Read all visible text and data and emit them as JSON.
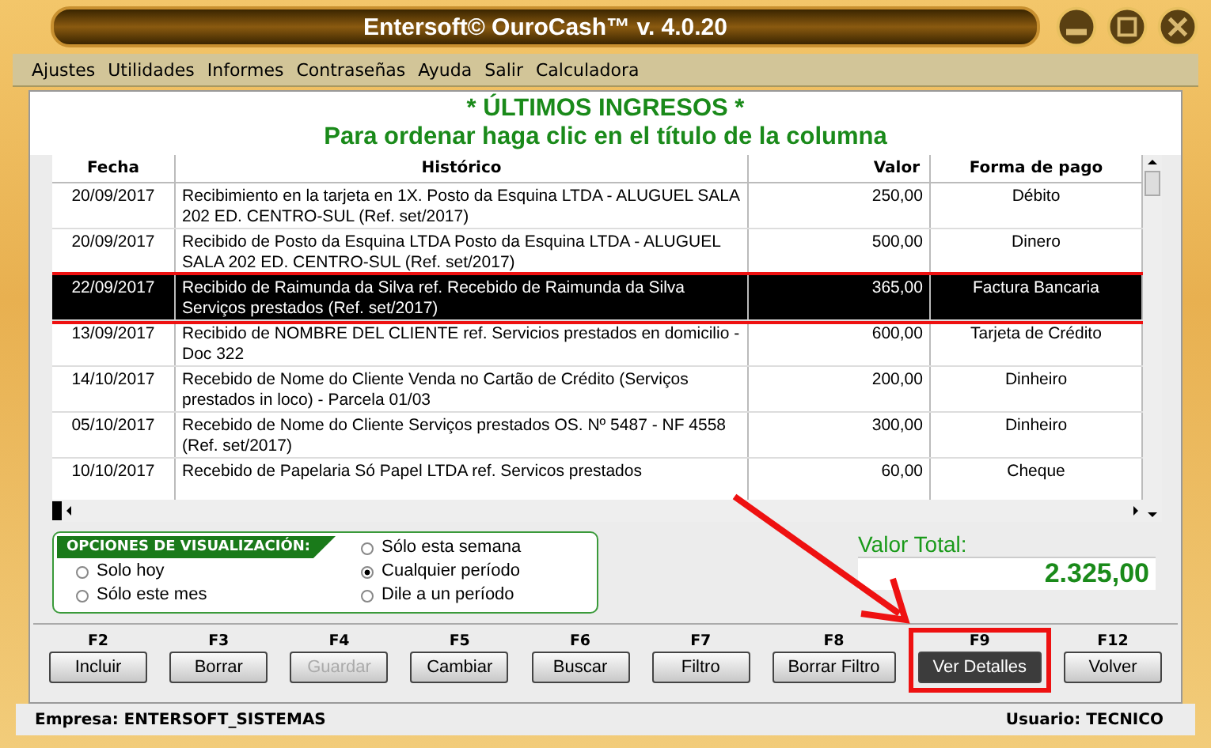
{
  "window": {
    "title": "Entersoft© OuroCash™ v. 4.0.20"
  },
  "menu": [
    "Ajustes",
    "Utilidades",
    "Informes",
    "Contraseñas",
    "Ayuda",
    "Salir",
    "Calculadora"
  ],
  "heading": "* ÚLTIMOS INGRESOS *",
  "subheading": "Para ordenar haga clic en el título de la columna",
  "table": {
    "columns": [
      "Fecha",
      "Histórico",
      "Valor",
      "Forma de pago"
    ],
    "rows": [
      {
        "cells": [
          "20/09/2017",
          "Recibimiento en la tarjeta en 1X. Posto da Esquina LTDA - ALUGUEL SALA 202 ED. CENTRO-SUL (Ref. set/2017)",
          "250,00",
          "Débito"
        ],
        "selected": false,
        "highlighted": false
      },
      {
        "cells": [
          "20/09/2017",
          "Recibido de Posto da Esquina LTDA Posto da Esquina LTDA - ALUGUEL SALA 202 ED. CENTRO-SUL (Ref. set/2017)",
          "500,00",
          "Dinero"
        ],
        "selected": false,
        "highlighted": false
      },
      {
        "cells": [
          "22/09/2017",
          "Recibido de Raimunda da Silva ref. Recebido de Raimunda da Silva Serviços prestados (Ref. set/2017)",
          "365,00",
          "Factura Bancaria"
        ],
        "selected": true,
        "highlighted": true
      },
      {
        "cells": [
          "13/09/2017",
          "Recibido de NOMBRE DEL CLIENTE ref. Servicios prestados en domicilio - Doc 322",
          "600,00",
          "Tarjeta de Crédito"
        ],
        "selected": false,
        "highlighted": false
      },
      {
        "cells": [
          "14/10/2017",
          "Recebido de Nome do Cliente Venda no Cartão de Crédito (Serviços prestados in loco) - Parcela 01/03",
          "200,00",
          "Dinheiro"
        ],
        "selected": false,
        "highlighted": false
      },
      {
        "cells": [
          "05/10/2017",
          "Recebido de Nome do Cliente Serviços prestados OS. Nº 5487 - NF 4558 (Ref. set/2017)",
          "300,00",
          "Dinheiro"
        ],
        "selected": false,
        "highlighted": false
      },
      {
        "cells": [
          "10/10/2017",
          "Recebido de Papelaria Só Papel LTDA ref. Servicos prestados",
          "60,00",
          "Cheque"
        ],
        "selected": false,
        "highlighted": false
      }
    ]
  },
  "view_options": {
    "title": "OPCIONES DE VISUALIZACIÓN:",
    "options_left": [
      {
        "label": "Solo hoy",
        "selected": false
      },
      {
        "label": "Sólo este mes",
        "selected": false
      }
    ],
    "options_right": [
      {
        "label": "Sólo esta semana",
        "selected": false
      },
      {
        "label": "Cualquier período",
        "selected": true
      },
      {
        "label": "Dile a un período",
        "selected": false
      }
    ]
  },
  "total": {
    "label": "Valor Total:",
    "value": "2.325,00"
  },
  "buttons": [
    {
      "key": "F2",
      "label": "Incluir",
      "disabled": false,
      "selected": false,
      "highlighted": false
    },
    {
      "key": "F3",
      "label": "Borrar",
      "disabled": false,
      "selected": false,
      "highlighted": false
    },
    {
      "key": "F4",
      "label": "Guardar",
      "disabled": true,
      "selected": false,
      "highlighted": false
    },
    {
      "key": "F5",
      "label": "Cambiar",
      "disabled": false,
      "selected": false,
      "highlighted": false
    },
    {
      "key": "F6",
      "label": "Buscar",
      "disabled": false,
      "selected": false,
      "highlighted": false
    },
    {
      "key": "F7",
      "label": "Filtro",
      "disabled": false,
      "selected": false,
      "highlighted": false
    },
    {
      "key": "F8",
      "label": "Borrar Filtro",
      "disabled": false,
      "selected": false,
      "highlighted": false
    },
    {
      "key": "F9",
      "label": "Ver Detalles",
      "disabled": false,
      "selected": true,
      "highlighted": true
    },
    {
      "key": "F12",
      "label": "Volver",
      "disabled": false,
      "selected": false,
      "highlighted": false
    }
  ],
  "status_bar": {
    "company": "Empresa: ENTERSOFT_SISTEMAS",
    "user": "Usuario: TECNICO"
  }
}
